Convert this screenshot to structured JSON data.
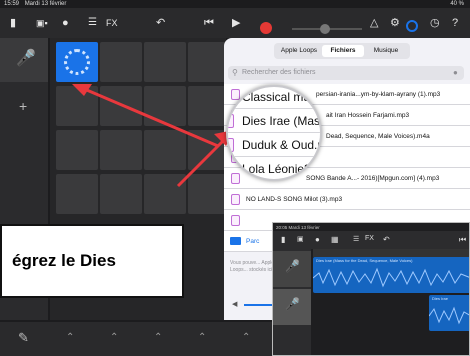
{
  "status": {
    "time": "15:59",
    "date": "Mardi 13 février",
    "battery": "40 %"
  },
  "toolbar": {
    "fx_label": "FX"
  },
  "browser": {
    "tabs": [
      "Apple Loops",
      "Fichiers",
      "Musique"
    ],
    "search_placeholder": "Rechercher des fichiers",
    "files": [
      "persian-irania...ym-by-klam-ayrany (1).mp3",
      "ait Iran Hossein Farjami.mp3",
      "Dead, Sequence, Male Voices).m4a",
      "",
      "SONG Bande A...- 2016)[Mpgun.com] (4).mp3",
      "NO LAND-S SONG Milot (3).mp3"
    ],
    "folder_label": "Parc",
    "footer_text": "Vous pouve... Apple Loops... stockés ici."
  },
  "magnifier": {
    "items": [
      "Classical mu",
      "Dies Irae (Mass",
      "Duduk & Oud.m",
      "Lola Léonie3"
    ]
  },
  "callout": {
    "text": "égrez le Dies"
  },
  "inset": {
    "time": "20:05",
    "date": "Mardi 13 février",
    "fx_label": "FX",
    "region1": "Dies Irae (Mass for the Dead, Sequence, Male Voices)",
    "region2": "Dies Irae"
  },
  "colors": {
    "accent": "#1a73e8",
    "record": "#e53935",
    "arrow": "#e8383d",
    "region": "#1565c0"
  }
}
